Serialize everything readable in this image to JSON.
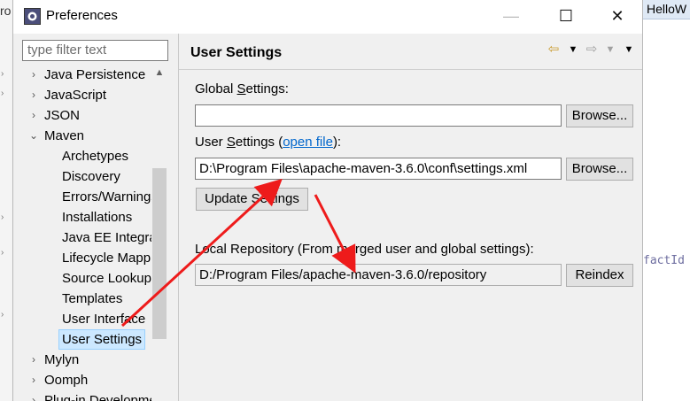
{
  "ide": {
    "left_fragment": "ro",
    "tab_label": "HelloW",
    "code_fragment": "factId"
  },
  "window": {
    "title": "Preferences",
    "minimize_glyph": "—",
    "maximize_glyph": "☐",
    "close_glyph": "✕"
  },
  "filter": {
    "placeholder": "type filter text"
  },
  "tree": {
    "items": [
      {
        "label": "Java Persistence",
        "state": "collapsed"
      },
      {
        "label": "JavaScript",
        "state": "collapsed"
      },
      {
        "label": "JSON",
        "state": "collapsed"
      },
      {
        "label": "Maven",
        "state": "expanded"
      },
      {
        "label": "Archetypes"
      },
      {
        "label": "Discovery"
      },
      {
        "label": "Errors/Warnings"
      },
      {
        "label": "Installations"
      },
      {
        "label": "Java EE Integration"
      },
      {
        "label": "Lifecycle Mappings"
      },
      {
        "label": "Source Lookup"
      },
      {
        "label": "Templates"
      },
      {
        "label": "User Interface"
      },
      {
        "label": "User Settings",
        "selected": true
      },
      {
        "label": "Mylyn",
        "state": "collapsed"
      },
      {
        "label": "Oomph",
        "state": "collapsed"
      },
      {
        "label": "Plug-in Development",
        "state": "collapsed"
      }
    ]
  },
  "page": {
    "title": "User Settings",
    "global_label_pre": "Global ",
    "global_label_u": "S",
    "global_label_post": "ettings:",
    "global_value": "",
    "browse_label": "Browse...",
    "user_label_pre": "User ",
    "user_label_u": "S",
    "user_label_mid": "ettings (",
    "user_link": "open file",
    "user_label_post": "):",
    "user_value": "D:\\Program Files\\apache-maven-3.6.0\\conf\\settings.xml",
    "update_label": "Update Settings",
    "local_label": "Local Repository (From merged user and global settings):",
    "local_value": "D:/Program Files/apache-maven-3.6.0/repository",
    "reindex_label": "Reindex",
    "nav_icons": [
      "back-arrow-icon",
      "dropdown-icon",
      "forward-arrow-icon",
      "dropdown-icon",
      "view-menu-icon"
    ]
  },
  "colors": {
    "annotation": "#ee1b1b",
    "selection": "#cce8ff",
    "link": "#0066cc"
  }
}
